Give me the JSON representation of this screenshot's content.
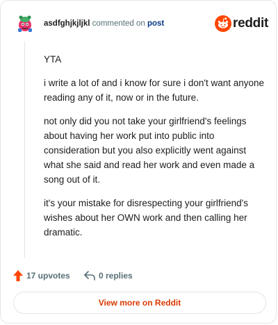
{
  "header": {
    "username": "asdfghjkjljkl",
    "commented_text": "commented on",
    "post_link": "post",
    "brand_name": "reddit"
  },
  "comment": {
    "paragraphs": [
      "YTA",
      "i write a lot of and i know for sure i don't want anyone reading any of it, now or in the future.",
      "not only did you not take your girlfriend's feelings about having her work put into public into consideration but you also explicitly went against what she said and read her work and even made a song out of it.",
      "it's your mistake for disrespecting your girlfriend's wishes about her OWN work and then calling her dramatic."
    ]
  },
  "actions": {
    "upvotes_label": "17 upvotes",
    "replies_label": "0 replies"
  },
  "footer": {
    "view_more_label": "View more on Reddit"
  },
  "colors": {
    "upvote_accent": "#ff4500",
    "link_accent": "#d93900",
    "reddit_orange": "#ff4500"
  }
}
